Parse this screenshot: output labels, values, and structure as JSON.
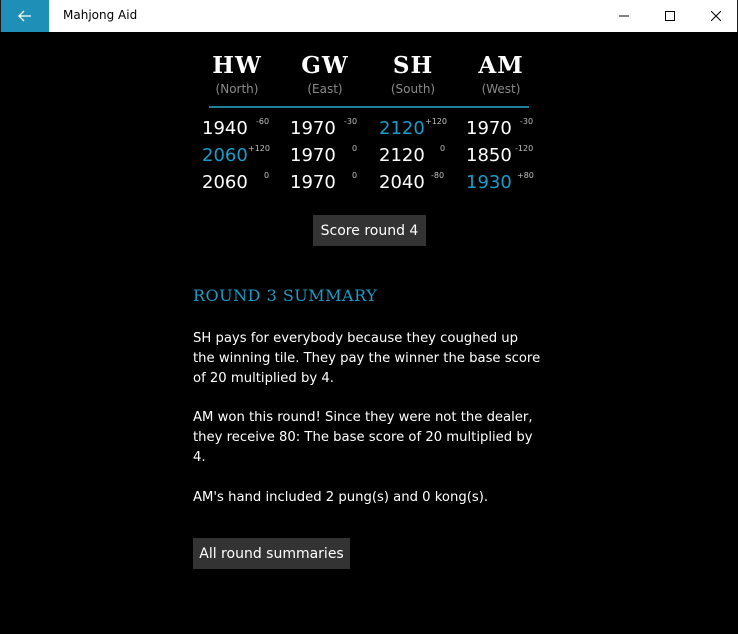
{
  "window": {
    "title": "Mahjong Aid",
    "back_label": "←",
    "min_label": "—",
    "max_label": "☐",
    "close_label": "✕"
  },
  "players": [
    {
      "name": "HW",
      "wind": "(North)"
    },
    {
      "name": "GW",
      "wind": "(East)"
    },
    {
      "name": "SH",
      "wind": "(South)"
    },
    {
      "name": "AM",
      "wind": "(West)"
    }
  ],
  "scores": {
    "rows": [
      [
        {
          "score": "1940",
          "delta": "-60"
        },
        {
          "score": "1970",
          "delta": "-30"
        },
        {
          "score": "2120",
          "delta": "+120"
        },
        {
          "score": "1970",
          "delta": "-30"
        }
      ],
      [
        {
          "score": "2060",
          "delta": "+120"
        },
        {
          "score": "1970",
          "delta": "0"
        },
        {
          "score": "2120",
          "delta": "0"
        },
        {
          "score": "1850",
          "delta": "-120"
        }
      ],
      [
        {
          "score": "2060",
          "delta": "0"
        },
        {
          "score": "1970",
          "delta": "0"
        },
        {
          "score": "2040",
          "delta": "-80"
        },
        {
          "score": "1930",
          "delta": "+80"
        }
      ]
    ],
    "highlight_color": "#1b9bc7"
  },
  "buttons": {
    "score_round": "Score round 4",
    "all_summaries": "All round summaries"
  },
  "summary": {
    "title": "ROUND 3 SUMMARY",
    "para1": "SH pays for everybody because they coughed up the winning tile. They pay the winner the base score of 20 multiplied by 4.",
    "para2": "AM won this round! Since they were not the dealer, they receive 80: The base score of 20 multiplied by 4.",
    "para3": "AM's hand included 2 pung(s) and 0 kong(s)."
  },
  "colors": {
    "accent": "#1e90b8",
    "background": "#000000"
  }
}
